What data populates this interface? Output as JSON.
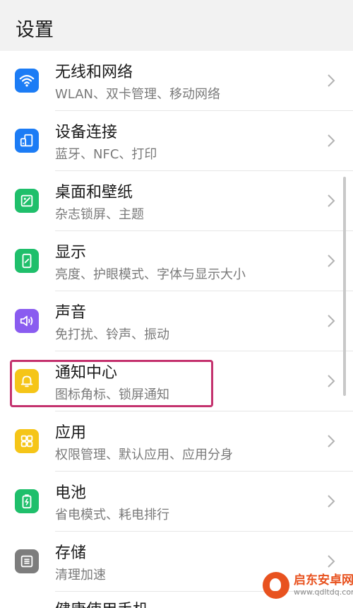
{
  "header": {
    "title": "设置"
  },
  "items": [
    {
      "icon": "wifi-icon",
      "color": "#1c7cf5",
      "title": "无线和网络",
      "subtitle": "WLAN、双卡管理、移动网络"
    },
    {
      "icon": "device-connect-icon",
      "color": "#1c7cf5",
      "title": "设备连接",
      "subtitle": "蓝牙、NFC、打印"
    },
    {
      "icon": "wallpaper-icon",
      "color": "#1fbf6b",
      "title": "桌面和壁纸",
      "subtitle": "杂志锁屏、主题"
    },
    {
      "icon": "display-icon",
      "color": "#1fbf6b",
      "title": "显示",
      "subtitle": "亮度、护眼模式、字体与显示大小"
    },
    {
      "icon": "sound-icon",
      "color": "#8a5cf0",
      "title": "声音",
      "subtitle": "免打扰、铃声、振动"
    },
    {
      "icon": "bell-icon",
      "color": "#f5c518",
      "title": "通知中心",
      "subtitle": "图标角标、锁屏通知"
    },
    {
      "icon": "apps-icon",
      "color": "#f5c518",
      "title": "应用",
      "subtitle": "权限管理、默认应用、应用分身"
    },
    {
      "icon": "battery-icon",
      "color": "#1fbf6b",
      "title": "电池",
      "subtitle": "省电模式、耗电排行"
    },
    {
      "icon": "storage-icon",
      "color": "#7d7d7d",
      "title": "存储",
      "subtitle": "清理加速"
    }
  ],
  "partial_item": {
    "title": "健康使用手机"
  },
  "highlight_color": "#c4326e",
  "watermark": {
    "name": "启东安卓网",
    "url": "www.qdltdq.com"
  }
}
